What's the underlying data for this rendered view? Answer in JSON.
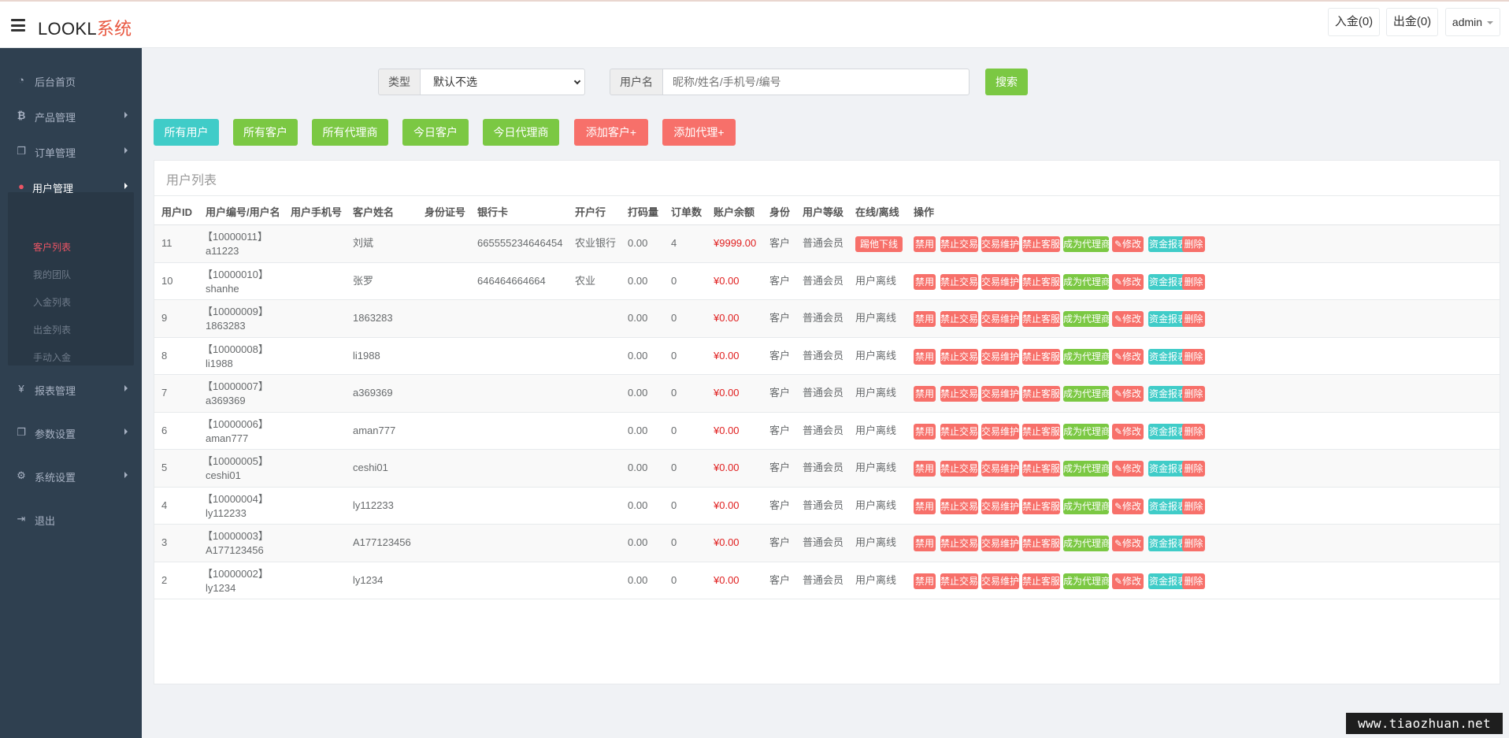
{
  "header": {
    "logo_main": "LOOKL",
    "logo_accent": "系统",
    "deposit_label": "入金(0)",
    "withdraw_label": "出金(0)",
    "admin_label": "admin",
    "menu_icon": "hamburger-icon"
  },
  "sidebar": {
    "items": [
      {
        "label": "后台首页",
        "icon": "tachometer-icon"
      },
      {
        "label": "产品管理",
        "icon": "bitcoin-icon"
      },
      {
        "label": "订单管理",
        "icon": "copy-icon"
      },
      {
        "label": "用户管理",
        "icon": "user-icon"
      },
      {
        "label": "报表管理",
        "icon": "yen-icon"
      },
      {
        "label": "参数设置",
        "icon": "copy-icon"
      },
      {
        "label": "系统设置",
        "icon": "cogs-icon"
      },
      {
        "label": "退出",
        "icon": "sign-out-icon"
      }
    ],
    "subitems": [
      {
        "label": "客户列表",
        "active": true
      },
      {
        "label": "我的团队",
        "active": false
      },
      {
        "label": "入金列表",
        "active": false
      },
      {
        "label": "出金列表",
        "active": false
      },
      {
        "label": "手动入金",
        "active": false
      }
    ]
  },
  "search": {
    "type_label": "类型",
    "type_value": "默认不选",
    "username_label": "用户名",
    "keyword_placeholder": "昵称/姓名/手机号/编号",
    "search_button": "搜索"
  },
  "filters": {
    "all_users": "所有用户",
    "all_customers": "所有客户",
    "all_agents": "所有代理商",
    "today_customers": "今日客户",
    "today_agents": "今日代理商",
    "add_customer": "添加客户+",
    "add_agent": "添加代理+"
  },
  "table": {
    "title": "用户列表",
    "headers": [
      "用户ID",
      "用户编号/用户名",
      "用户手机号",
      "客户姓名",
      "身份证号",
      "银行卡",
      "开户行",
      "打码量",
      "订单数",
      "账户余额",
      "身份",
      "用户等级",
      "在线/离线",
      "操作"
    ],
    "actions": {
      "disable": "禁用",
      "ban_trade": "禁止交易",
      "trade_maint": "交易维护",
      "ban_service": "禁止客服",
      "make_agent": "成为代理商",
      "edit": "修改",
      "report": "资金报表",
      "delete": "删除"
    },
    "rows": [
      {
        "id": "11",
        "code": "【10000011】",
        "username": "a11223",
        "phone": "",
        "name": "刘斌",
        "idcard": "",
        "bank_card": "665555234646454",
        "bank": "农业银行",
        "volume": "0.00",
        "orders": "4",
        "balance": "¥9999.00",
        "role": "客户",
        "level": "普通会员",
        "status": "踢他下线",
        "online": true
      },
      {
        "id": "10",
        "code": "【10000010】",
        "username": "shanhe",
        "phone": "",
        "name": "张罗",
        "idcard": "",
        "bank_card": "646464664664",
        "bank": "农业",
        "volume": "0.00",
        "orders": "0",
        "balance": "¥0.00",
        "role": "客户",
        "level": "普通会员",
        "status": "用户离线",
        "online": false
      },
      {
        "id": "9",
        "code": "【10000009】",
        "username": "1863283",
        "phone": "",
        "name": "1863283",
        "idcard": "",
        "bank_card": "",
        "bank": "",
        "volume": "0.00",
        "orders": "0",
        "balance": "¥0.00",
        "role": "客户",
        "level": "普通会员",
        "status": "用户离线",
        "online": false
      },
      {
        "id": "8",
        "code": "【10000008】",
        "username": "li1988",
        "phone": "",
        "name": "li1988",
        "idcard": "",
        "bank_card": "",
        "bank": "",
        "volume": "0.00",
        "orders": "0",
        "balance": "¥0.00",
        "role": "客户",
        "level": "普通会员",
        "status": "用户离线",
        "online": false
      },
      {
        "id": "7",
        "code": "【10000007】",
        "username": "a369369",
        "phone": "",
        "name": "a369369",
        "idcard": "",
        "bank_card": "",
        "bank": "",
        "volume": "0.00",
        "orders": "0",
        "balance": "¥0.00",
        "role": "客户",
        "level": "普通会员",
        "status": "用户离线",
        "online": false
      },
      {
        "id": "6",
        "code": "【10000006】",
        "username": "aman777",
        "phone": "",
        "name": "aman777",
        "idcard": "",
        "bank_card": "",
        "bank": "",
        "volume": "0.00",
        "orders": "0",
        "balance": "¥0.00",
        "role": "客户",
        "level": "普通会员",
        "status": "用户离线",
        "online": false
      },
      {
        "id": "5",
        "code": "【10000005】",
        "username": "ceshi01",
        "phone": "",
        "name": "ceshi01",
        "idcard": "",
        "bank_card": "",
        "bank": "",
        "volume": "0.00",
        "orders": "0",
        "balance": "¥0.00",
        "role": "客户",
        "level": "普通会员",
        "status": "用户离线",
        "online": false
      },
      {
        "id": "4",
        "code": "【10000004】",
        "username": "ly112233",
        "phone": "",
        "name": "ly112233",
        "idcard": "",
        "bank_card": "",
        "bank": "",
        "volume": "0.00",
        "orders": "0",
        "balance": "¥0.00",
        "role": "客户",
        "level": "普通会员",
        "status": "用户离线",
        "online": false
      },
      {
        "id": "3",
        "code": "【10000003】",
        "username": "A177123456",
        "phone": "",
        "name": "A177123456",
        "idcard": "",
        "bank_card": "",
        "bank": "",
        "volume": "0.00",
        "orders": "0",
        "balance": "¥0.00",
        "role": "客户",
        "level": "普通会员",
        "status": "用户离线",
        "online": false
      },
      {
        "id": "2",
        "code": "【10000002】",
        "username": "ly1234",
        "phone": "",
        "name": "ly1234",
        "idcard": "",
        "bank_card": "",
        "bank": "",
        "volume": "0.00",
        "orders": "0",
        "balance": "¥0.00",
        "role": "客户",
        "level": "普通会员",
        "status": "用户离线",
        "online": false
      }
    ]
  },
  "watermark": "www.tiaozhuan.net",
  "colors": {
    "sidebar_bg": "#2f4050",
    "teal": "#40ccc8",
    "green": "#7bc843",
    "coral": "#f7706a",
    "balance_red": "#e01f1f",
    "logo_accent": "#e8553e"
  }
}
